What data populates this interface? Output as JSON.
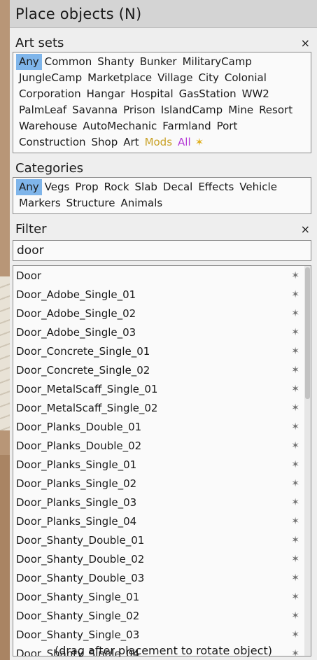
{
  "title": "Place objects (N)",
  "art_sets": {
    "heading": "Art sets",
    "close": "×",
    "items": [
      "Any",
      "Common",
      "Shanty",
      "Bunker",
      "MilitaryCamp",
      "JungleCamp",
      "Marketplace",
      "Village",
      "City",
      "Colonial",
      "Corporation",
      "Hangar",
      "Hospital",
      "GasStation",
      "WW2",
      "PalmLeaf",
      "Savanna",
      "Prison",
      "IslandCamp",
      "Mine",
      "Resort",
      "Warehouse",
      "AutoMechanic",
      "Farmland",
      "Port",
      "Construction",
      "Shop",
      "Art"
    ],
    "mods": "Mods",
    "all": "All",
    "star": "✶"
  },
  "categories": {
    "heading": "Categories",
    "items": [
      "Any",
      "Vegs",
      "Prop",
      "Rock",
      "Slab",
      "Decal",
      "Effects",
      "Vehicle",
      "Markers",
      "Structure",
      "Animals"
    ]
  },
  "filter": {
    "heading": "Filter",
    "close": "×",
    "value": "door"
  },
  "objects": [
    "Door",
    "Door_Adobe_Single_01",
    "Door_Adobe_Single_02",
    "Door_Adobe_Single_03",
    "Door_Concrete_Single_01",
    "Door_Concrete_Single_02",
    "Door_MetalScaff_Single_01",
    "Door_MetalScaff_Single_02",
    "Door_Planks_Double_01",
    "Door_Planks_Double_02",
    "Door_Planks_Single_01",
    "Door_Planks_Single_02",
    "Door_Planks_Single_03",
    "Door_Planks_Single_04",
    "Door_Shanty_Double_01",
    "Door_Shanty_Double_02",
    "Door_Shanty_Double_03",
    "Door_Shanty_Single_01",
    "Door_Shanty_Single_02",
    "Door_Shanty_Single_03",
    "Door_Shanty_Single_04"
  ],
  "fav_glyph": "✶",
  "footer": "(drag after placement to rotate object)"
}
